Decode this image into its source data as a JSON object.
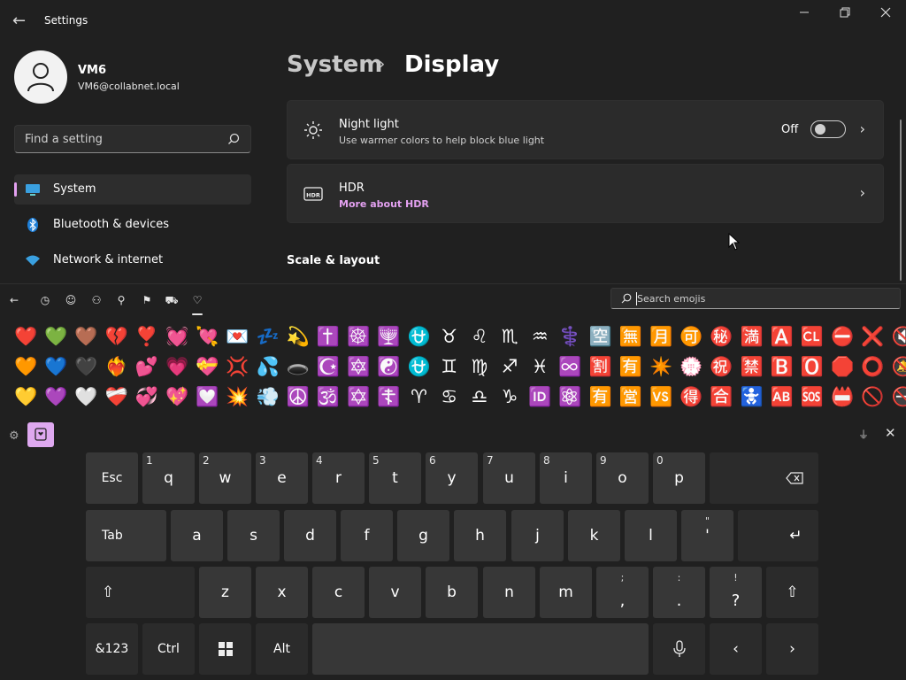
{
  "window": {
    "title": "Settings",
    "back_icon": "arrow-left-icon",
    "controls": [
      "minimize-icon",
      "restore-icon",
      "close-icon"
    ]
  },
  "user": {
    "name": "VM6",
    "email": "VM6@collabnet.local"
  },
  "search": {
    "placeholder": "Find a setting"
  },
  "nav": {
    "items": [
      {
        "label": "System",
        "icon": "monitor-icon",
        "active": true
      },
      {
        "label": "Bluetooth & devices",
        "icon": "bluetooth-icon"
      },
      {
        "label": "Network & internet",
        "icon": "wifi-icon"
      }
    ]
  },
  "breadcrumb": {
    "parent": "System",
    "separator": "›",
    "current": "Display"
  },
  "cards": [
    {
      "title": "Night light",
      "subtitle": "Use warmer colors to help block blue light",
      "icon": "brightness-icon",
      "toggle_label": "Off",
      "toggle_on": false
    },
    {
      "title": "HDR",
      "subtitle": "More about HDR",
      "icon": "hdr-icon"
    }
  ],
  "section": {
    "scale_layout": "Scale & layout"
  },
  "accent_color": "#e3a0f0",
  "emoji_panel": {
    "tabs": [
      "back-icon",
      "recent-icon",
      "smiley-icon",
      "people-icon",
      "celebration-icon",
      "food-icon",
      "travel-icon",
      "vehicle-icon",
      "heart-icon"
    ],
    "active_tab": "heart-icon",
    "search_placeholder": "Search emojis",
    "rows": [
      [
        "❤️",
        "💚",
        "🤎",
        "💔",
        "❣️",
        "💓",
        "💘",
        "💌",
        "💤",
        "💫",
        "✝️",
        "☸️",
        "🕎",
        "⛎",
        "♉",
        "♌",
        "♏",
        "♒",
        "⚕️",
        "🈳",
        "🈚",
        "🈷️",
        "🉑",
        "㊙️",
        "🈵",
        "🅰️",
        "🆑",
        "⛔",
        "❌",
        "🔇"
      ],
      [
        "🧡",
        "💙",
        "🖤",
        "❤️‍🔥",
        "💕",
        "💗",
        "💝",
        "💢",
        "💦",
        "🕳️",
        "☪️",
        "🔯",
        "☯️",
        "⛎",
        "♊",
        "♍",
        "♐",
        "♓",
        "♾️",
        "🈹",
        "🈶",
        "✴️",
        "💮",
        "㊗️",
        "🈲",
        "🅱️",
        "🅾️",
        "🛑",
        "⭕",
        "🔕"
      ],
      [
        "💛",
        "💜",
        "🤍",
        "❤️‍🩹",
        "💞",
        "💖",
        "💟",
        "💥",
        "💨",
        "☮️",
        "🕉️",
        "✡️",
        "☦️",
        "♈",
        "♋",
        "♎",
        "♑",
        "🆔",
        "⚛️",
        "🈶",
        "🈺",
        "🆚",
        "🉐",
        "🈴",
        "🚼",
        "🆎",
        "🆘",
        "📛",
        "🚫",
        "🚭"
      ]
    ]
  },
  "keyboard": {
    "emoji_button_color": "#dea8ef",
    "row1": [
      {
        "label": "Esc"
      },
      {
        "label": "q",
        "num": "1"
      },
      {
        "label": "w",
        "num": "2"
      },
      {
        "label": "e",
        "num": "3"
      },
      {
        "label": "r",
        "num": "4"
      },
      {
        "label": "t",
        "num": "5"
      },
      {
        "label": "y",
        "num": "6"
      },
      {
        "label": "u",
        "num": "7"
      },
      {
        "label": "i",
        "num": "8"
      },
      {
        "label": "o",
        "num": "9"
      },
      {
        "label": "p",
        "num": "0"
      },
      {
        "label": "⌫"
      }
    ],
    "row2": [
      {
        "label": "Tab"
      },
      {
        "label": "a"
      },
      {
        "label": "s"
      },
      {
        "label": "d"
      },
      {
        "label": "f"
      },
      {
        "label": "g"
      },
      {
        "label": "h"
      },
      {
        "label": "j"
      },
      {
        "label": "k"
      },
      {
        "label": "l"
      },
      {
        "label": "'",
        "alt": "\""
      },
      {
        "label": "↵"
      }
    ],
    "row3": [
      {
        "label": "⇧"
      },
      {
        "label": "z"
      },
      {
        "label": "x"
      },
      {
        "label": "c"
      },
      {
        "label": "v"
      },
      {
        "label": "b"
      },
      {
        "label": "n"
      },
      {
        "label": "m"
      },
      {
        "label": ",",
        "alt": ";"
      },
      {
        "label": ".",
        "alt": ":"
      },
      {
        "label": "?",
        "alt": "!"
      },
      {
        "label": "⇧"
      }
    ],
    "row4": [
      {
        "label": "&123"
      },
      {
        "label": "Ctrl"
      },
      {
        "label": "windows-icon"
      },
      {
        "label": "Alt"
      },
      {
        "label": ""
      },
      {
        "label": "microphone-icon"
      },
      {
        "label": "‹"
      },
      {
        "label": "›"
      }
    ]
  }
}
